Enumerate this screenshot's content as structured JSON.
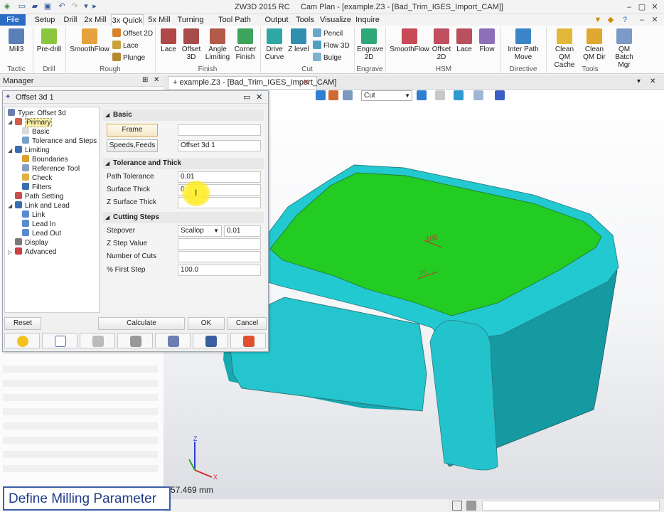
{
  "app": {
    "title": "ZW3D 2015 RC",
    "doc_title": "Cam Plan - [example.Z3 - [Bad_Trim_IGES_Import_CAM]]",
    "colors": {
      "accent": "#2b6cc4",
      "surface_green": "#22cc22",
      "surface_cyan": "#21c8cf"
    }
  },
  "menu": [
    "File",
    "Setup",
    "Drill",
    "2x Mill",
    "3x Quick",
    "5x Mill",
    "Turning",
    "Tool Path Editor",
    "Output",
    "Tools",
    "Visualize",
    "Inquire"
  ],
  "ribbon": {
    "tactic": {
      "group": "Tactic",
      "mill3": "Mill3"
    },
    "drill": {
      "group": "Drill",
      "predrill": "Pre-drill"
    },
    "rough": {
      "group": "Rough",
      "smoothflow": "SmoothFlow",
      "offset2d": "Offset 2D",
      "lace": "Lace",
      "plunge": "Plunge"
    },
    "finish": {
      "group": "Finish",
      "lace": "Lace",
      "offset3d": "Offset 3D",
      "angle": "Angle Limiting",
      "corner": "Corner Finish"
    },
    "cut": {
      "group": "Cut",
      "drivecurve": "Drive Curve",
      "zlevel": "Z level",
      "pencil": "Pencil",
      "flow3d": "Flow 3D",
      "bulge": "Bulge"
    },
    "engrave": {
      "group": "Engrave",
      "engrave2d": "Engrave 2D"
    },
    "hsm": {
      "group": "HSM",
      "smoothflow": "SmoothFlow",
      "offset2d": "Offset 2D",
      "lace": "Lace",
      "flow": "Flow"
    },
    "directive": {
      "group": "Directive",
      "inter": "Inter Path Move"
    },
    "tools": {
      "group": "Tools",
      "cleancache": "Clean QM Cache",
      "cleandir": "Clean QM Dir",
      "batch": "QM Batch Mgr"
    }
  },
  "manager": {
    "title": "Manager"
  },
  "doc_tab": {
    "label": "example.Z3 - [Bad_Trim_IGES_Import_CAM]"
  },
  "viewport": {
    "cut_select": "Cut"
  },
  "model_labels": {
    "a": "100",
    "b": "75"
  },
  "dialog": {
    "title": "Offset 3d 1",
    "tree": {
      "type": "Type: Offset 3d",
      "primary": "Primary",
      "basic": "Basic",
      "tolerance": "Tolerance and Steps",
      "limiting": "Limiting",
      "boundaries": "Boundaries",
      "reftool": "Reference Tool",
      "check": "Check",
      "filters": "Filters",
      "pathsetting": "Path Setting",
      "linklead": "Link and Lead",
      "link": "Link",
      "leadin": "Lead In",
      "leadout": "Lead Out",
      "display": "Display",
      "advanced": "Advanced"
    },
    "basic": {
      "heading": "Basic",
      "frame_btn": "Frame",
      "speeds_btn": "Speeds,Feeds",
      "speeds_value": "Offset 3d 1"
    },
    "tolerance": {
      "heading": "Tolerance and Thick",
      "path_tol_label": "Path Tolerance",
      "path_tol_value": "0.01",
      "surface_thick_label": "Surface Thick",
      "surface_thick_value": "0",
      "z_surface_label": "Z Surface Thick"
    },
    "cutting": {
      "heading": "Cutting Steps",
      "stepover_label": "Stepover",
      "stepover_mode": "Scallop",
      "stepover_value": "0.01",
      "zstep_label": "Z Step Value",
      "numcuts_label": "Number of Cuts",
      "firststep_label": "% First Step",
      "firststep_value": "100.0"
    },
    "buttons": {
      "reset": "Reset",
      "calculate": "Calculate",
      "ok": "OK",
      "cancel": "Cancel"
    }
  },
  "status": {
    "caption": "Define Milling Parameter",
    "coords": "57.469 mm"
  }
}
